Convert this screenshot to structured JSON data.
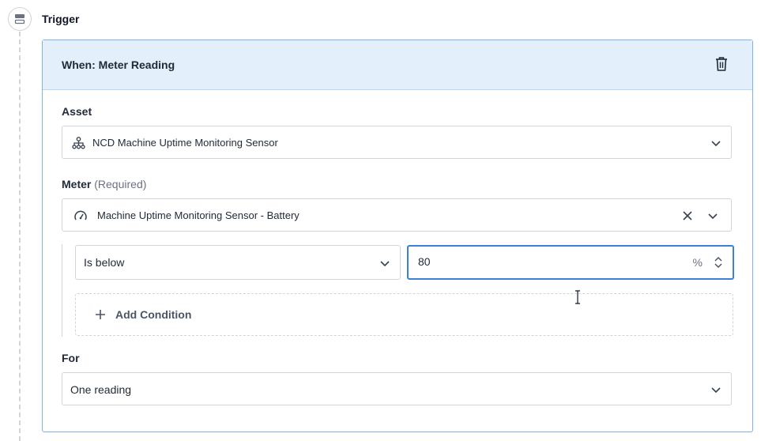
{
  "trigger": {
    "label": "Trigger"
  },
  "card": {
    "title": "When: Meter Reading",
    "asset": {
      "label": "Asset",
      "value": "NCD Machine Uptime Monitoring Sensor"
    },
    "meter": {
      "label": "Meter",
      "required_text": "(Required)",
      "value": "Machine Uptime Monitoring Sensor - Battery"
    },
    "condition": {
      "operator": "Is below",
      "value": "80",
      "unit": "%"
    },
    "add_condition_label": "Add Condition",
    "for": {
      "label": "For",
      "value": "One reading"
    }
  },
  "icons": {
    "trigger": "trigger-block-icon",
    "delete": "trash-icon",
    "asset": "hierarchy-icon",
    "meter": "gauge-icon",
    "clear": "close-icon",
    "dropdown": "chevron-down-icon",
    "stepper": "stepper-icon",
    "add": "plus-icon"
  },
  "colors": {
    "accent": "#3b82d6",
    "header_bg": "#e3f0fc",
    "card_border": "#7cb3e8"
  }
}
